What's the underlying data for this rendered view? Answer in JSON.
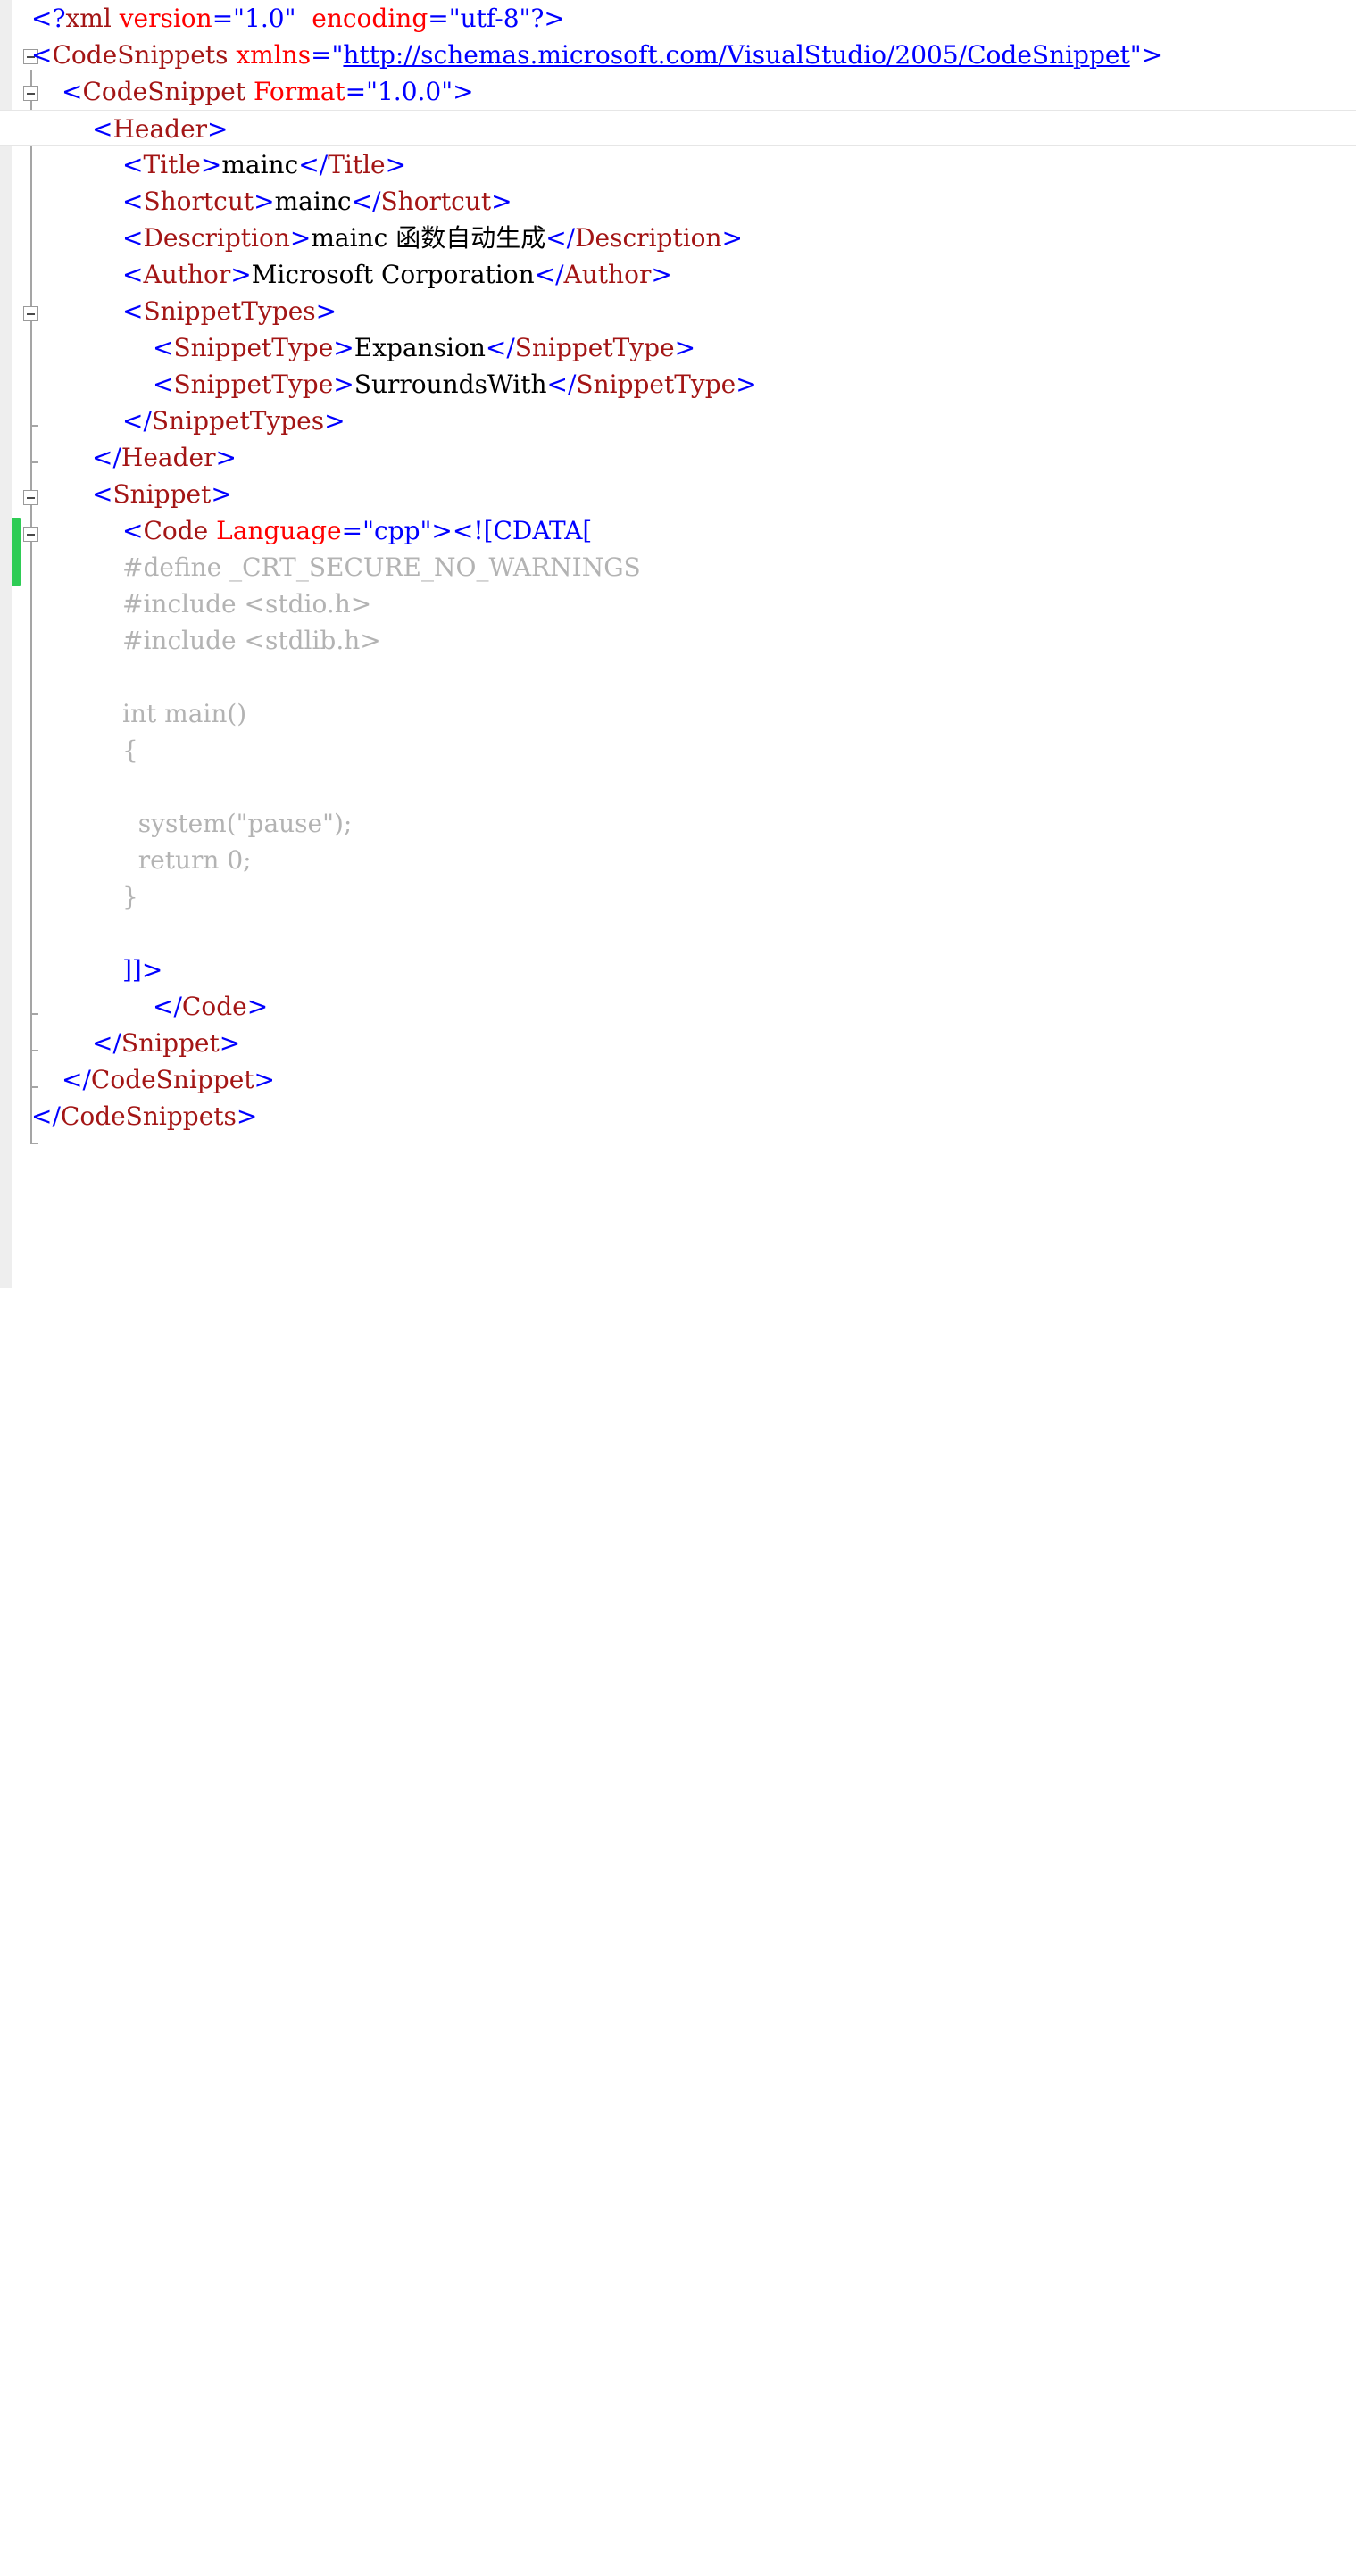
{
  "editor": {
    "app": "visual-studio-xml-editor",
    "file_kind": "code-snippet-xml",
    "current_line_index": 3,
    "colors": {
      "punctuation": "#0000FF",
      "tag_name": "#A31515",
      "attribute_name": "#FF0000",
      "attribute_value": "#0000FF",
      "text_content": "#000000",
      "cdata_payload": "#B3B3B3",
      "hyperlink": "#0000FF",
      "change_bar": "#2ECC55",
      "gutter_background": "#EEEEEE",
      "page_background": "#FFFFFF"
    },
    "gutter": {
      "change_bar_label": "unsaved-changes-bar",
      "collapse_boxes": 5,
      "collapse_glyph": "−"
    }
  },
  "document": {
    "xml_declaration": {
      "open": "<?",
      "name": "xml",
      "attr1_name": "version",
      "attr1_value": "\"1.0\"",
      "attr2_name": "encoding",
      "attr2_value": "\"utf-8\"",
      "close": "?>"
    },
    "lines": [
      {
        "indent": 0,
        "kind": "pi"
      },
      {
        "indent": 0,
        "kind": "open-tag-with-url",
        "tag": "CodeSnippets",
        "attr": "xmlns",
        "value": "http://schemas.microsoft.com/VisualStudio/2005/CodeSnippet"
      },
      {
        "indent": 1,
        "kind": "open-tag-attr",
        "tag": "CodeSnippet",
        "attr": "Format",
        "value": "\"1.0.0\""
      },
      {
        "indent": 2,
        "kind": "open-tag",
        "tag": "Header"
      },
      {
        "indent": 3,
        "kind": "element",
        "tag": "Title",
        "text": "mainc"
      },
      {
        "indent": 3,
        "kind": "element",
        "tag": "Shortcut",
        "text": "mainc"
      },
      {
        "indent": 3,
        "kind": "element",
        "tag": "Description",
        "text": "mainc 函数自动生成"
      },
      {
        "indent": 3,
        "kind": "element",
        "tag": "Author",
        "text": "Microsoft Corporation"
      },
      {
        "indent": 3,
        "kind": "open-tag",
        "tag": "SnippetTypes"
      },
      {
        "indent": 4,
        "kind": "element",
        "tag": "SnippetType",
        "text": "Expansion"
      },
      {
        "indent": 4,
        "kind": "element",
        "tag": "SnippetType",
        "text": "SurroundsWith"
      },
      {
        "indent": 3,
        "kind": "close-tag",
        "tag": "SnippetTypes"
      },
      {
        "indent": 2,
        "kind": "close-tag",
        "tag": "Header"
      },
      {
        "indent": 2,
        "kind": "open-tag",
        "tag": "Snippet"
      },
      {
        "indent": 3,
        "kind": "code-open",
        "tag": "Code",
        "attr": "Language",
        "value": "\"cpp\"",
        "cdata": "<![CDATA["
      },
      {
        "indent": 3,
        "kind": "cdata",
        "text": "#define _CRT_SECURE_NO_WARNINGS"
      },
      {
        "indent": 3,
        "kind": "cdata",
        "text": "#include <stdio.h>"
      },
      {
        "indent": 3,
        "kind": "cdata",
        "text": "#include <stdlib.h>"
      },
      {
        "indent": 3,
        "kind": "cdata",
        "text": ""
      },
      {
        "indent": 3,
        "kind": "cdata",
        "text": "int main()"
      },
      {
        "indent": 3,
        "kind": "cdata",
        "text": "{"
      },
      {
        "indent": 3,
        "kind": "cdata",
        "text": ""
      },
      {
        "indent": 3,
        "kind": "cdata",
        "text": "  system(\"pause\");"
      },
      {
        "indent": 3,
        "kind": "cdata",
        "text": "  return 0;"
      },
      {
        "indent": 3,
        "kind": "cdata",
        "text": "}"
      },
      {
        "indent": 3,
        "kind": "cdata",
        "text": ""
      },
      {
        "indent": 3,
        "kind": "cdata-end",
        "text": "]]>"
      },
      {
        "indent": 4,
        "kind": "close-tag",
        "tag": "Code"
      },
      {
        "indent": 3,
        "kind": "close-tag",
        "tag": "Snippet"
      },
      {
        "indent": 2,
        "kind": "close-tag",
        "tag": "CodeSnippet"
      },
      {
        "indent": 1,
        "kind": "close-tag",
        "tag": "CodeSnippets"
      }
    ],
    "text": {
      "l1_lt": "<",
      "l1_q": "?",
      "l1_xml": "xml",
      "l1_sp1": " ",
      "l1_version": "version",
      "l1_eq1": "=",
      "l1_v1": "\"1.0\"",
      "l1_sp2": "  ",
      "l1_encoding": "encoding",
      "l1_eq2": "=",
      "l1_v2": "\"utf-8\"",
      "l1_end": "?>",
      "l2_lt": "<",
      "l2_tag": "CodeSnippets",
      "l2_sp": " ",
      "l2_attr": "xmlns",
      "l2_eq": "=",
      "l2_q1": "\"",
      "l2_url": "http://schemas.microsoft.com/VisualStudio/2005/CodeSnippet",
      "l2_q2": "\"",
      "l2_gt": ">",
      "l3_lt": "<",
      "l3_tag": "CodeSnippet",
      "l3_sp": " ",
      "l3_attr": "Format",
      "l3_eq": "=",
      "l3_val": "\"1.0.0\"",
      "l3_gt": ">",
      "l4_lt": "<",
      "l4_tag": "Header",
      "l4_gt": ">",
      "l5_lt": "<",
      "l5_tag": "Title",
      "l5_gt": ">",
      "l5_text": "mainc",
      "l5_lt2": "</",
      "l5_tag2": "Title",
      "l5_gt2": ">",
      "l6_lt": "<",
      "l6_tag": "Shortcut",
      "l6_gt": ">",
      "l6_text": "mainc",
      "l6_lt2": "</",
      "l6_tag2": "Shortcut",
      "l6_gt2": ">",
      "l7_lt": "<",
      "l7_tag": "Description",
      "l7_gt": ">",
      "l7_text": "mainc 函数自动生成",
      "l7_lt2": "</",
      "l7_tag2": "Description",
      "l7_gt2": ">",
      "l8_lt": "<",
      "l8_tag": "Author",
      "l8_gt": ">",
      "l8_text": "Microsoft Corporation",
      "l8_lt2": "</",
      "l8_tag2": "Author",
      "l8_gt2": ">",
      "l9_lt": "<",
      "l9_tag": "SnippetTypes",
      "l9_gt": ">",
      "l10_lt": "<",
      "l10_tag": "SnippetType",
      "l10_gt": ">",
      "l10_text": "Expansion",
      "l10_lt2": "</",
      "l10_tag2": "SnippetType",
      "l10_gt2": ">",
      "l11_lt": "<",
      "l11_tag": "SnippetType",
      "l11_gt": ">",
      "l11_text": "SurroundsWith",
      "l11_lt2": "</",
      "l11_tag2": "SnippetType",
      "l11_gt2": ">",
      "l12_lt": "</",
      "l12_tag": "SnippetTypes",
      "l12_gt": ">",
      "l13_lt": "</",
      "l13_tag": "Header",
      "l13_gt": ">",
      "l14_lt": "<",
      "l14_tag": "Snippet",
      "l14_gt": ">",
      "l15_lt": "<",
      "l15_tag": "Code",
      "l15_sp": " ",
      "l15_attr": "Language",
      "l15_eq": "=",
      "l15_val": "\"cpp\"",
      "l15_gt": ">",
      "l15_cdata": "<![CDATA[",
      "l16": "#define _CRT_SECURE_NO_WARNINGS",
      "l17": "#include <stdio.h>",
      "l18": "#include <stdlib.h>",
      "l20": "int main()",
      "l21": "{",
      "l23": "  system(\"pause\");",
      "l24": "  return 0;",
      "l25": "}",
      "l27": "]]>",
      "l28_lt": "</",
      "l28_tag": "Code",
      "l28_gt": ">",
      "l29_lt": "</",
      "l29_tag": "Snippet",
      "l29_gt": ">",
      "l30_lt": "</",
      "l30_tag": "CodeSnippet",
      "l30_gt": ">",
      "l31_lt": "</",
      "l31_tag": "CodeSnippets",
      "l31_gt": ">"
    }
  }
}
